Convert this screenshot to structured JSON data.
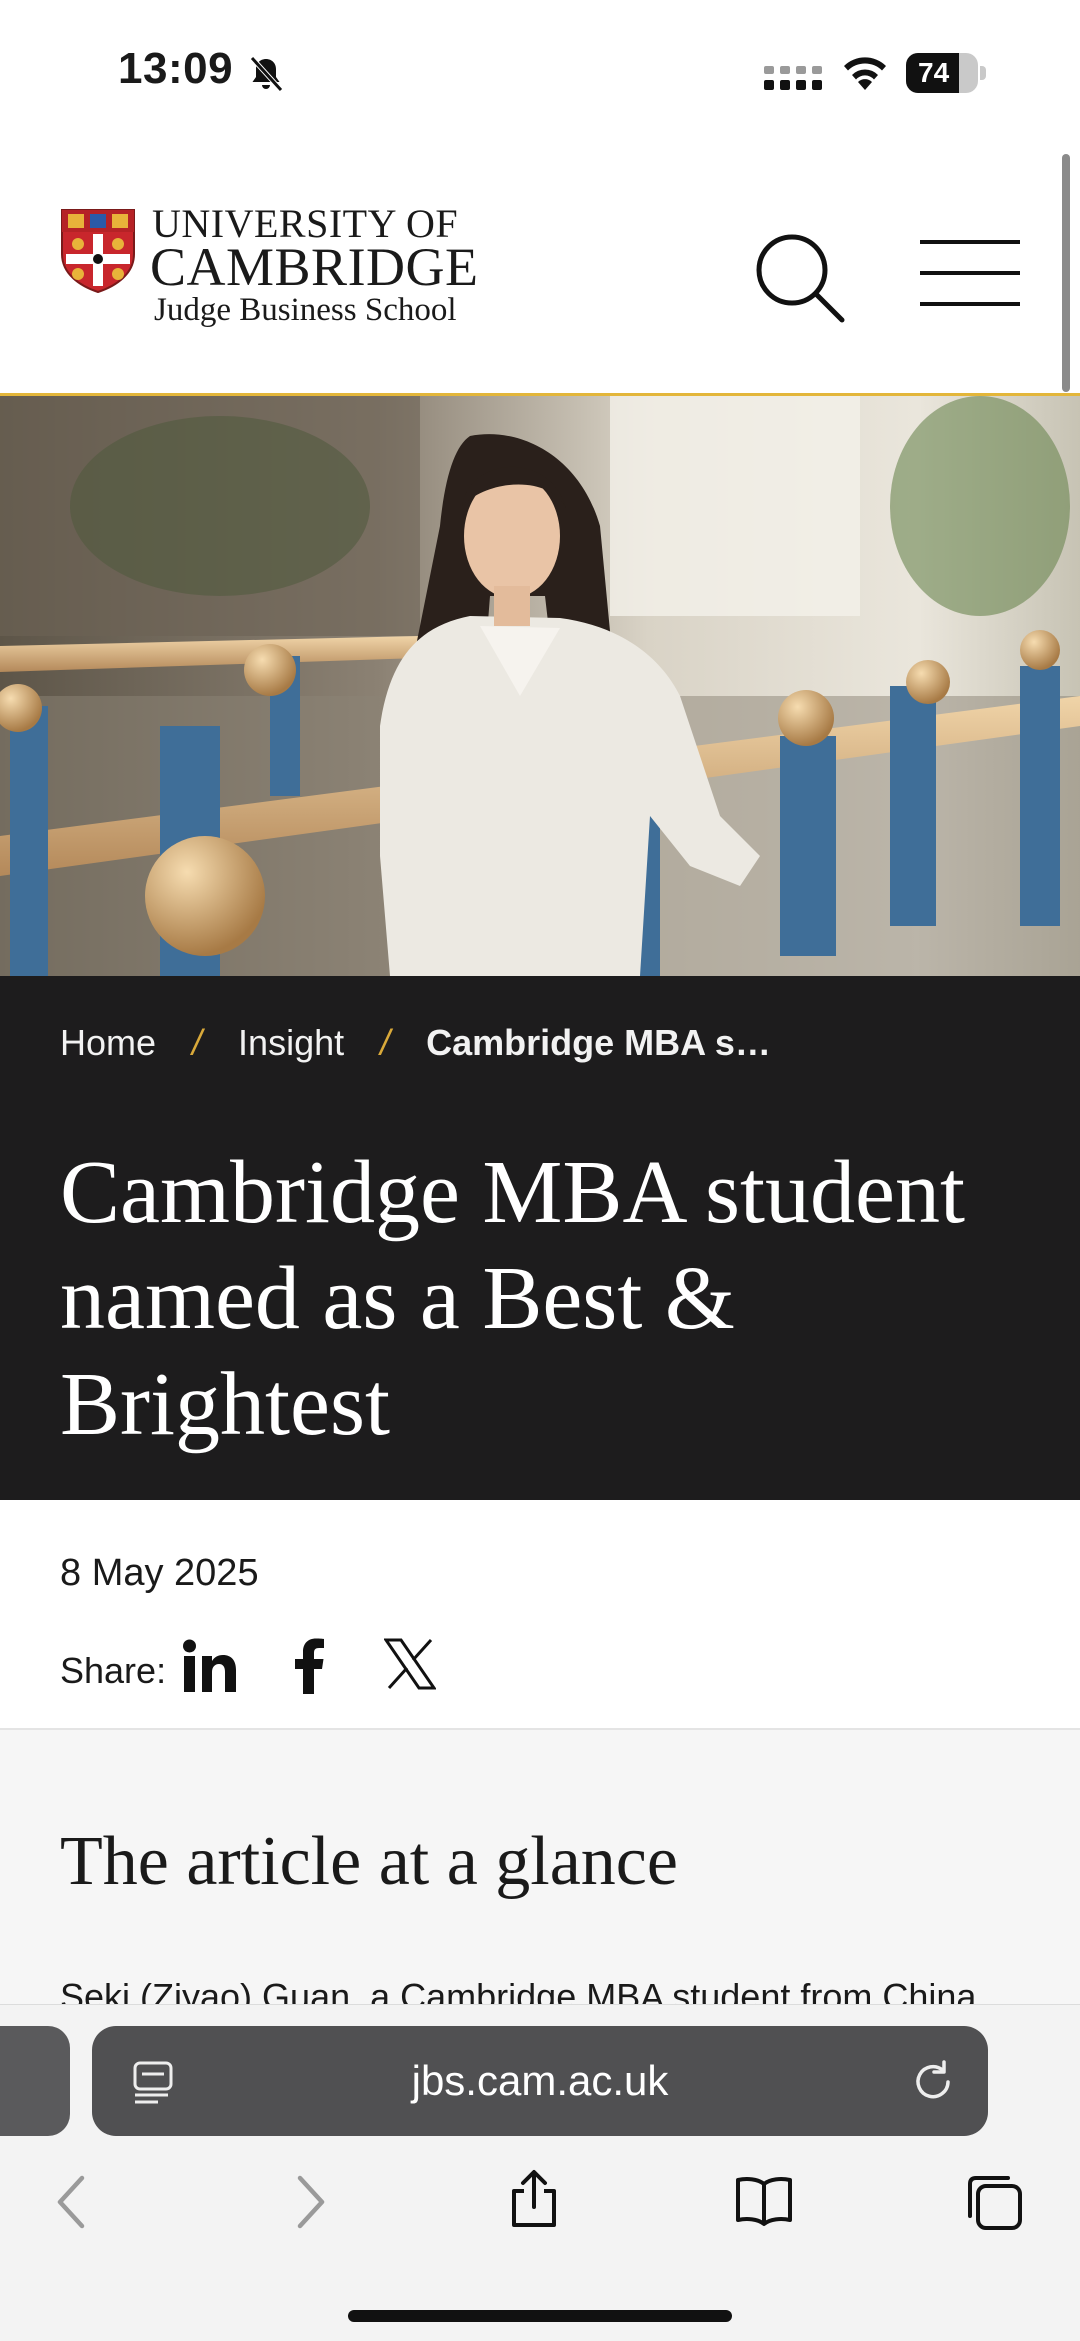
{
  "status_bar": {
    "time": "13:09",
    "battery_level": "74",
    "battery_fraction": 0.74
  },
  "header": {
    "logo_line1": "UNIVERSITY OF",
    "logo_line2": "CAMBRIDGE",
    "logo_line3": "Judge Business School"
  },
  "hero": {
    "description_icon": "hero-photo"
  },
  "breadcrumb": {
    "home": "Home",
    "separator": "/",
    "insight": "Insight",
    "current": "Cambridge MBA s…"
  },
  "article": {
    "title": "Cambridge MBA student named as a Best & Brightest",
    "date": "8 May 2025",
    "share_label": "Share:",
    "glance_title": "The article at a glance",
    "glance_text": "Seki (Ziyao) Guan, a Cambridge MBA student from China"
  },
  "browser": {
    "url": "jbs.cam.ac.uk"
  },
  "colors": {
    "accent_gold": "#e3b63a",
    "title_band": "#1d1c1d",
    "url_bar": "#505052"
  }
}
